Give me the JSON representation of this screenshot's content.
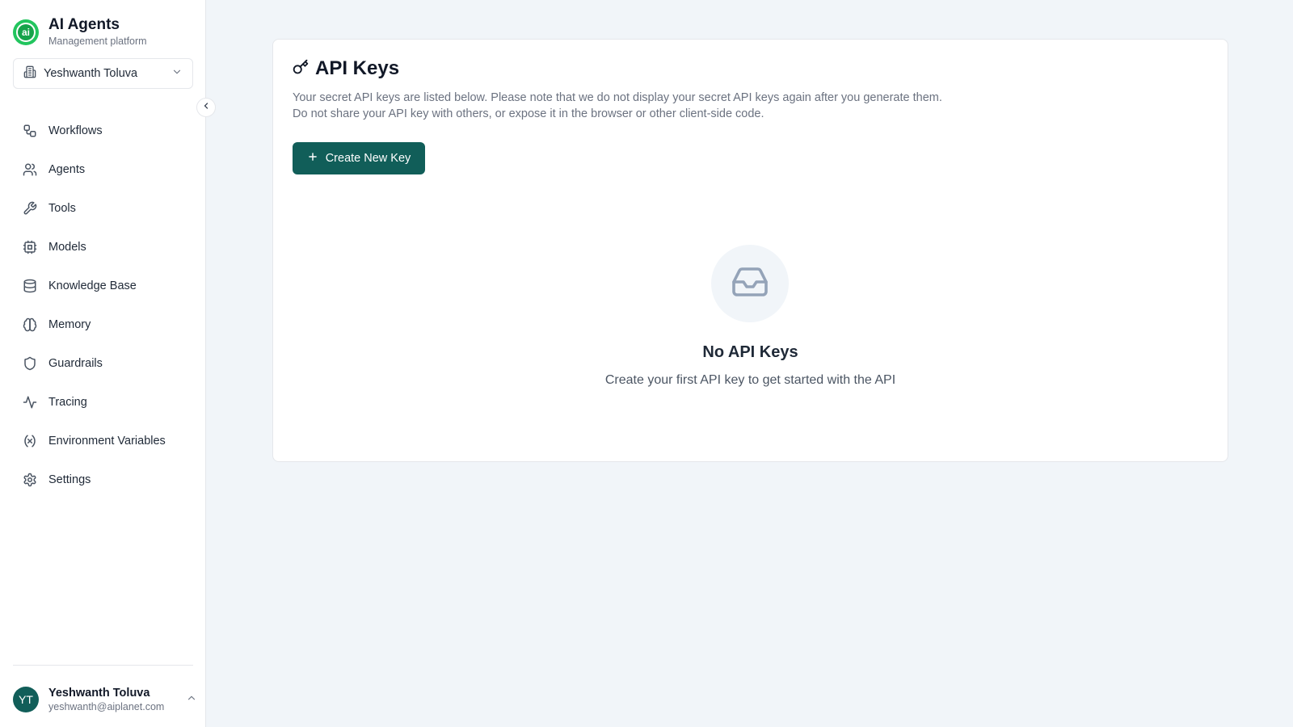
{
  "brand": {
    "logo_text": "ai",
    "title": "AI Agents",
    "subtitle": "Management platform"
  },
  "org": {
    "name": "Yeshwanth Toluva"
  },
  "sidebar": {
    "items": [
      {
        "label": "Workflows",
        "icon": "workflow-icon"
      },
      {
        "label": "Agents",
        "icon": "users-icon"
      },
      {
        "label": "Tools",
        "icon": "wrench-icon"
      },
      {
        "label": "Models",
        "icon": "cpu-icon"
      },
      {
        "label": "Knowledge Base",
        "icon": "database-icon"
      },
      {
        "label": "Memory",
        "icon": "brain-icon"
      },
      {
        "label": "Guardrails",
        "icon": "shield-icon"
      },
      {
        "label": "Tracing",
        "icon": "activity-icon"
      },
      {
        "label": "Environment Variables",
        "icon": "variable-icon"
      },
      {
        "label": "Settings",
        "icon": "gear-icon"
      }
    ]
  },
  "user": {
    "initials": "YT",
    "name": "Yeshwanth Toluva",
    "email": "yeshwanth@aiplanet.com"
  },
  "main": {
    "title": "API Keys",
    "description_line1": "Your secret API keys are listed below. Please note that we do not display your secret API keys again after you generate them.",
    "description_line2": "Do not share your API key with others, or expose it in the browser or other client-side code.",
    "create_button_label": "Create New Key",
    "empty_title": "No API Keys",
    "empty_subtitle": "Create your first API key to get started with the API"
  },
  "colors": {
    "accent": "#115e59",
    "brand_green": "#22c55e",
    "background": "#f1f5f9"
  }
}
